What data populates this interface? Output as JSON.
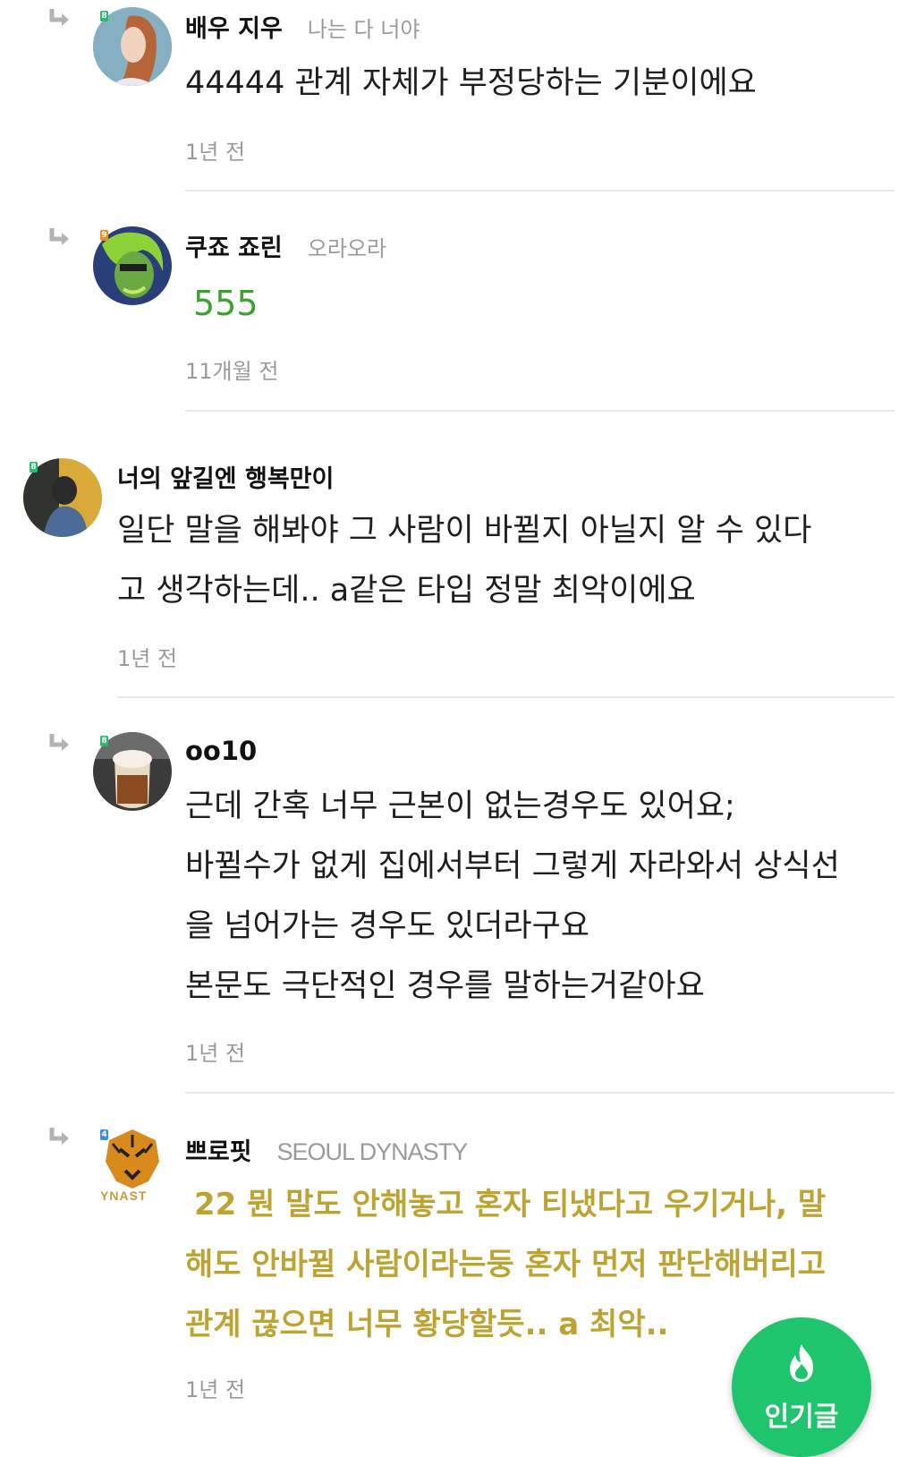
{
  "comments": [
    {
      "nickname": "배우 지우",
      "status": "나는 다 너야",
      "lines": [
        "44444 관계 자체가 부정당하는 기분이에요"
      ],
      "time": "1년 전",
      "badge_color": "#2cb870",
      "badge_text": "8"
    },
    {
      "nickname": "쿠죠 죠린",
      "status": "오라오라",
      "lines": [
        "555"
      ],
      "time": "11개월 전",
      "badge_color": "#f08a24",
      "badge_text": "9"
    },
    {
      "nickname": "너의 앞길엔 행복만이",
      "lines": [
        "일단 말을 해봐야 그 사람이 바뀔지 아닐지 알 수 있다",
        "고 생각하는데.. a같은 타입 정말 최악이에요"
      ],
      "time": "1년 전",
      "badge_color": "#2cb870",
      "badge_text": "8"
    },
    {
      "nickname": "oo10",
      "lines": [
        "근데 간혹 너무 근본이 없는경우도 있어요;",
        "바뀔수가 없게 집에서부터 그렇게 자라와서 상식선",
        "을 넘어가는 경우도 있더라구요",
        "본문도 극단적인 경우를 말하는거같아요"
      ],
      "time": "1년 전",
      "badge_color": "#2cb870",
      "badge_text": "8"
    },
    {
      "nickname": "쁘로핏",
      "status": "SEOUL DYNASTY",
      "lines": [
        "22 뭔 말도 안해놓고 혼자 티냈다고 우기거나, 말",
        "해도 안바뀔 사람이라는둥 혼자 먼저 판단해버리고",
        "관계 끊으면 너무 황당할듯.. a 최악.."
      ],
      "time": "1년 전",
      "badge_color": "#3a8ee6",
      "badge_text": "4"
    }
  ],
  "avatar_text": "YNAST",
  "fab": {
    "label": "인기글",
    "icon": "flame-icon",
    "color": "#1ec56c"
  },
  "colors": {
    "highlight_green": "#3aa32e",
    "highlight_gold": "#bda432"
  }
}
